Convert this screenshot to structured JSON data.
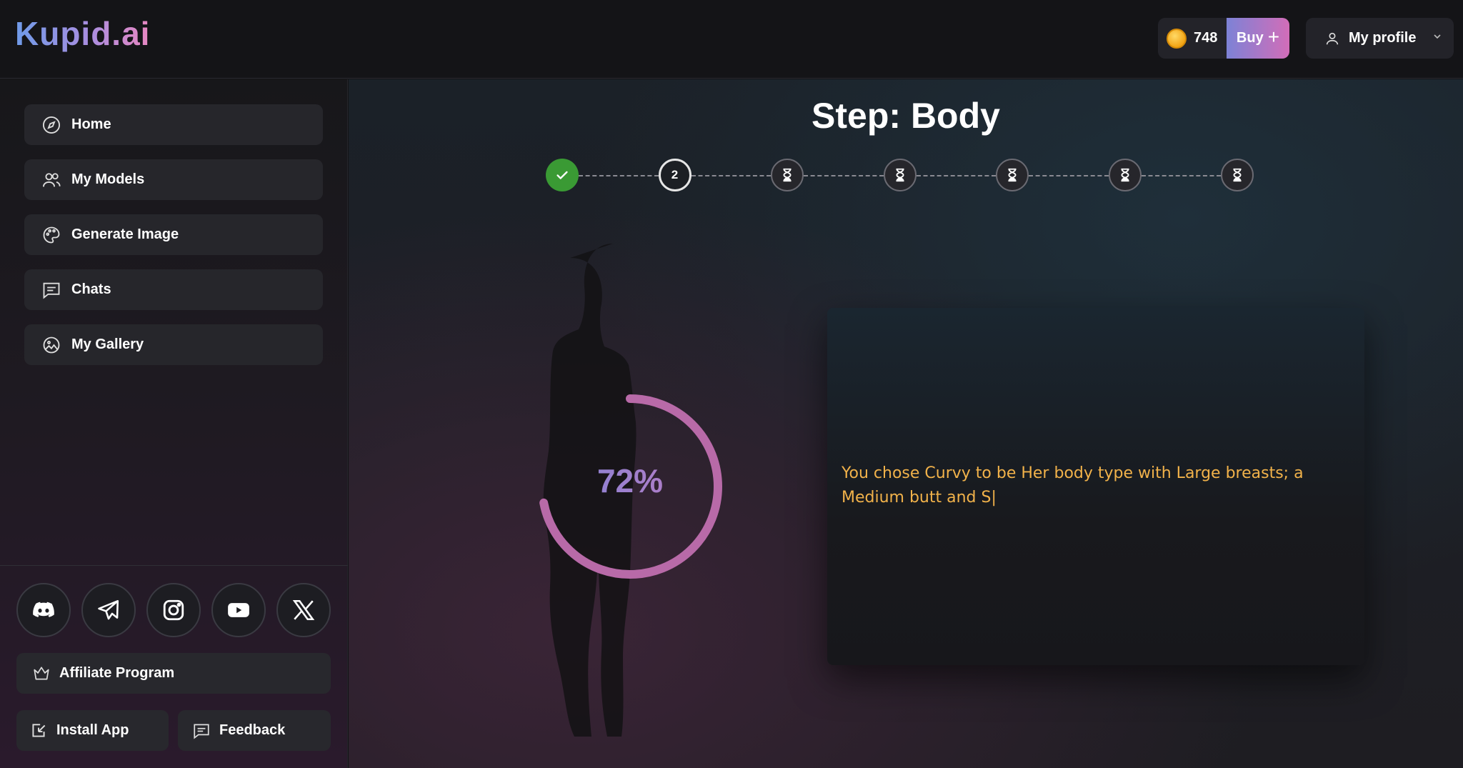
{
  "header": {
    "logo": "Kupid.ai",
    "coins": "748",
    "buy_label": "Buy",
    "buy_plus": "+",
    "profile_label": "My profile"
  },
  "sidebar": {
    "items": [
      {
        "label": "Home",
        "icon": "compass-icon"
      },
      {
        "label": "My Models",
        "icon": "users-icon"
      },
      {
        "label": "Generate Image",
        "icon": "palette-icon"
      },
      {
        "label": "Chats",
        "icon": "chat-icon"
      },
      {
        "label": "My Gallery",
        "icon": "gallery-icon"
      }
    ],
    "socials": [
      "discord-icon",
      "telegram-icon",
      "instagram-icon",
      "youtube-icon",
      "x-icon"
    ],
    "affiliate_label": "Affiliate Program",
    "install_label": "Install App",
    "feedback_label": "Feedback"
  },
  "main": {
    "title": "Step: Body",
    "stepper": {
      "total": 7,
      "current": 2,
      "current_label": "2",
      "states": [
        "done",
        "current",
        "pending",
        "pending",
        "pending",
        "pending",
        "pending"
      ]
    },
    "progress": {
      "value": 0.72,
      "label": "72%"
    },
    "description": "You chose Curvy to be Her body type with Large breasts; a Medium butt and S|"
  },
  "colors": {
    "accent_start": "#7c84d8",
    "accent_end": "#d26db8",
    "done_green": "#3a9a34",
    "description_text": "#f1b24a",
    "ring": "#b86aa8"
  }
}
